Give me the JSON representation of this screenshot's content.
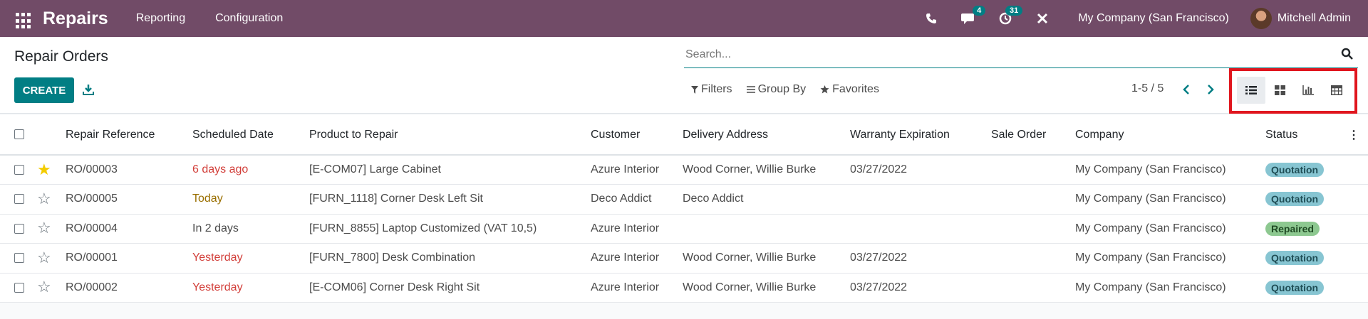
{
  "app": {
    "name": "Repairs",
    "menu": [
      "Reporting",
      "Configuration"
    ],
    "messages_badge": "4",
    "activities_badge": "31",
    "company": "My Company (San Francisco)",
    "user": "Mitchell Admin"
  },
  "page": {
    "title": "Repair Orders",
    "create_label": "CREATE",
    "search_placeholder": "Search...",
    "filters_label": "Filters",
    "groupby_label": "Group By",
    "favorites_label": "Favorites",
    "pager": "1-5 / 5"
  },
  "views": [
    "list-view-icon",
    "kanban-view-icon",
    "graph-view-icon",
    "pivot-view-icon"
  ],
  "table": {
    "columns": [
      "Repair Reference",
      "Scheduled Date",
      "Product to Repair",
      "Customer",
      "Delivery Address",
      "Warranty Expiration",
      "Sale Order",
      "Company",
      "Status"
    ],
    "rows": [
      {
        "starred": true,
        "ref": "RO/00003",
        "date": "6 days ago",
        "date_style": "red",
        "product": "[E-COM07] Large Cabinet",
        "customer": "Azure Interior",
        "address": "Wood Corner, Willie Burke",
        "warranty": "03/27/2022",
        "sale_order": "",
        "company": "My Company (San Francisco)",
        "status": "Quotation"
      },
      {
        "starred": false,
        "ref": "RO/00005",
        "date": "Today",
        "date_style": "amber",
        "product": "[FURN_1118] Corner Desk Left Sit",
        "customer": "Deco Addict",
        "address": "Deco Addict",
        "warranty": "",
        "sale_order": "",
        "company": "My Company (San Francisco)",
        "status": "Quotation"
      },
      {
        "starred": false,
        "ref": "RO/00004",
        "date": "In 2 days",
        "date_style": "normal",
        "product": "[FURN_8855] Laptop Customized (VAT 10,5)",
        "customer": "Azure Interior",
        "address": "",
        "warranty": "",
        "sale_order": "",
        "company": "My Company (San Francisco)",
        "status": "Repaired"
      },
      {
        "starred": false,
        "ref": "RO/00001",
        "date": "Yesterday",
        "date_style": "red",
        "product": "[FURN_7800] Desk Combination",
        "customer": "Azure Interior",
        "address": "Wood Corner, Willie Burke",
        "warranty": "03/27/2022",
        "sale_order": "",
        "company": "My Company (San Francisco)",
        "status": "Quotation"
      },
      {
        "starred": false,
        "ref": "RO/00002",
        "date": "Yesterday",
        "date_style": "red",
        "product": "[E-COM06] Corner Desk Right Sit",
        "customer": "Azure Interior",
        "address": "Wood Corner, Willie Burke",
        "warranty": "03/27/2022",
        "sale_order": "",
        "company": "My Company (San Francisco)",
        "status": "Quotation"
      }
    ]
  },
  "colors": {
    "topbar": "#714b67",
    "primary": "#017e84",
    "quotation_tag": "#87c5d2",
    "repaired_tag": "#8dc890",
    "highlight_box": "#e0161e"
  }
}
